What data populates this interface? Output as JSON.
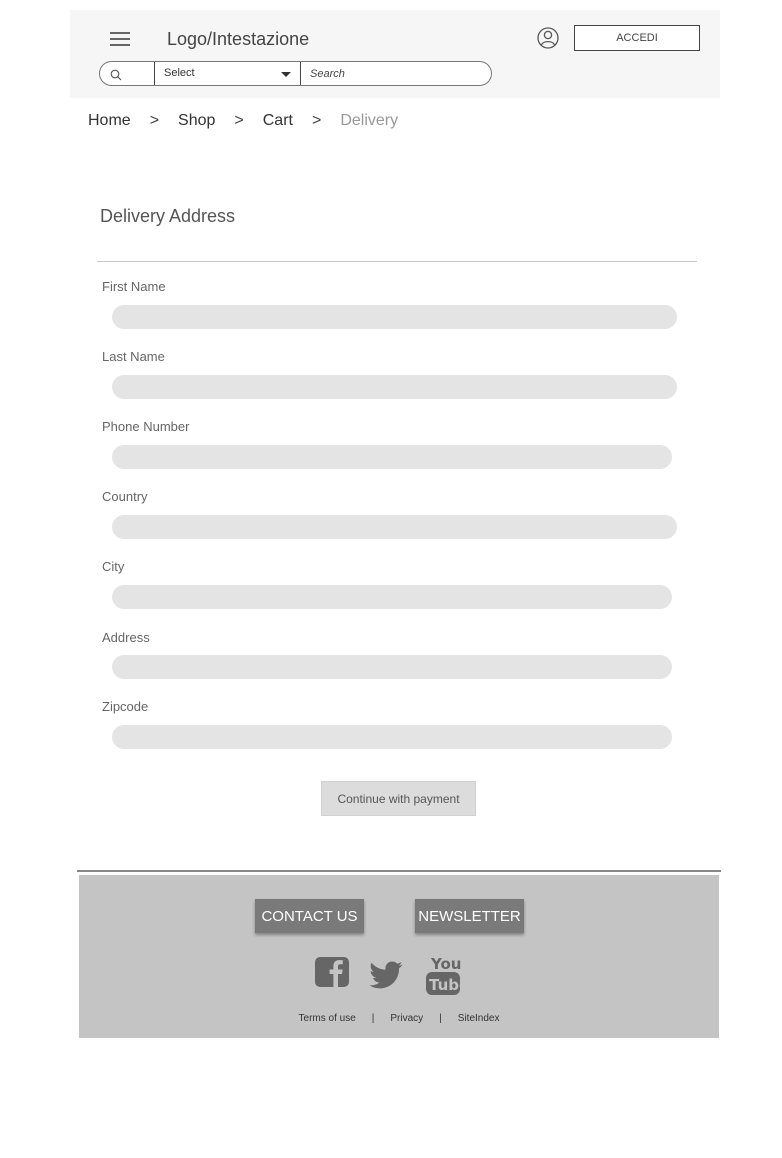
{
  "header": {
    "logo_text": "Logo/Intestazione",
    "login_label": "ACCEDI",
    "search": {
      "select_value": "Select",
      "placeholder": "Search"
    }
  },
  "breadcrumb": {
    "items": [
      "Home",
      "Shop",
      "Cart"
    ],
    "separator": ">",
    "current": "Delivery"
  },
  "form": {
    "title": "Delivery Address",
    "fields": [
      {
        "label": "First Name",
        "value": ""
      },
      {
        "label": "Last Name",
        "value": ""
      },
      {
        "label": "Phone Number",
        "value": ""
      },
      {
        "label": "Country",
        "value": ""
      },
      {
        "label": "City",
        "value": ""
      },
      {
        "label": "Address",
        "value": ""
      },
      {
        "label": "Zipcode",
        "value": ""
      }
    ],
    "submit_label": "Continue with payment"
  },
  "footer": {
    "contact_label": "CONTACT US",
    "newsletter_label": "NEWSLETTER",
    "social_icons": [
      "facebook-icon",
      "twitter-icon",
      "youtube-icon"
    ],
    "links": [
      "Terms of use",
      "Privacy",
      "SiteIndex"
    ],
    "link_separator": "|"
  },
  "colors": {
    "header_bg": "#f6f6f6",
    "input_bg": "#e4e4e4",
    "footer_bg": "#c4c4c4",
    "footer_button_bg": "#7a7a7a",
    "social_icon": "#666666"
  }
}
